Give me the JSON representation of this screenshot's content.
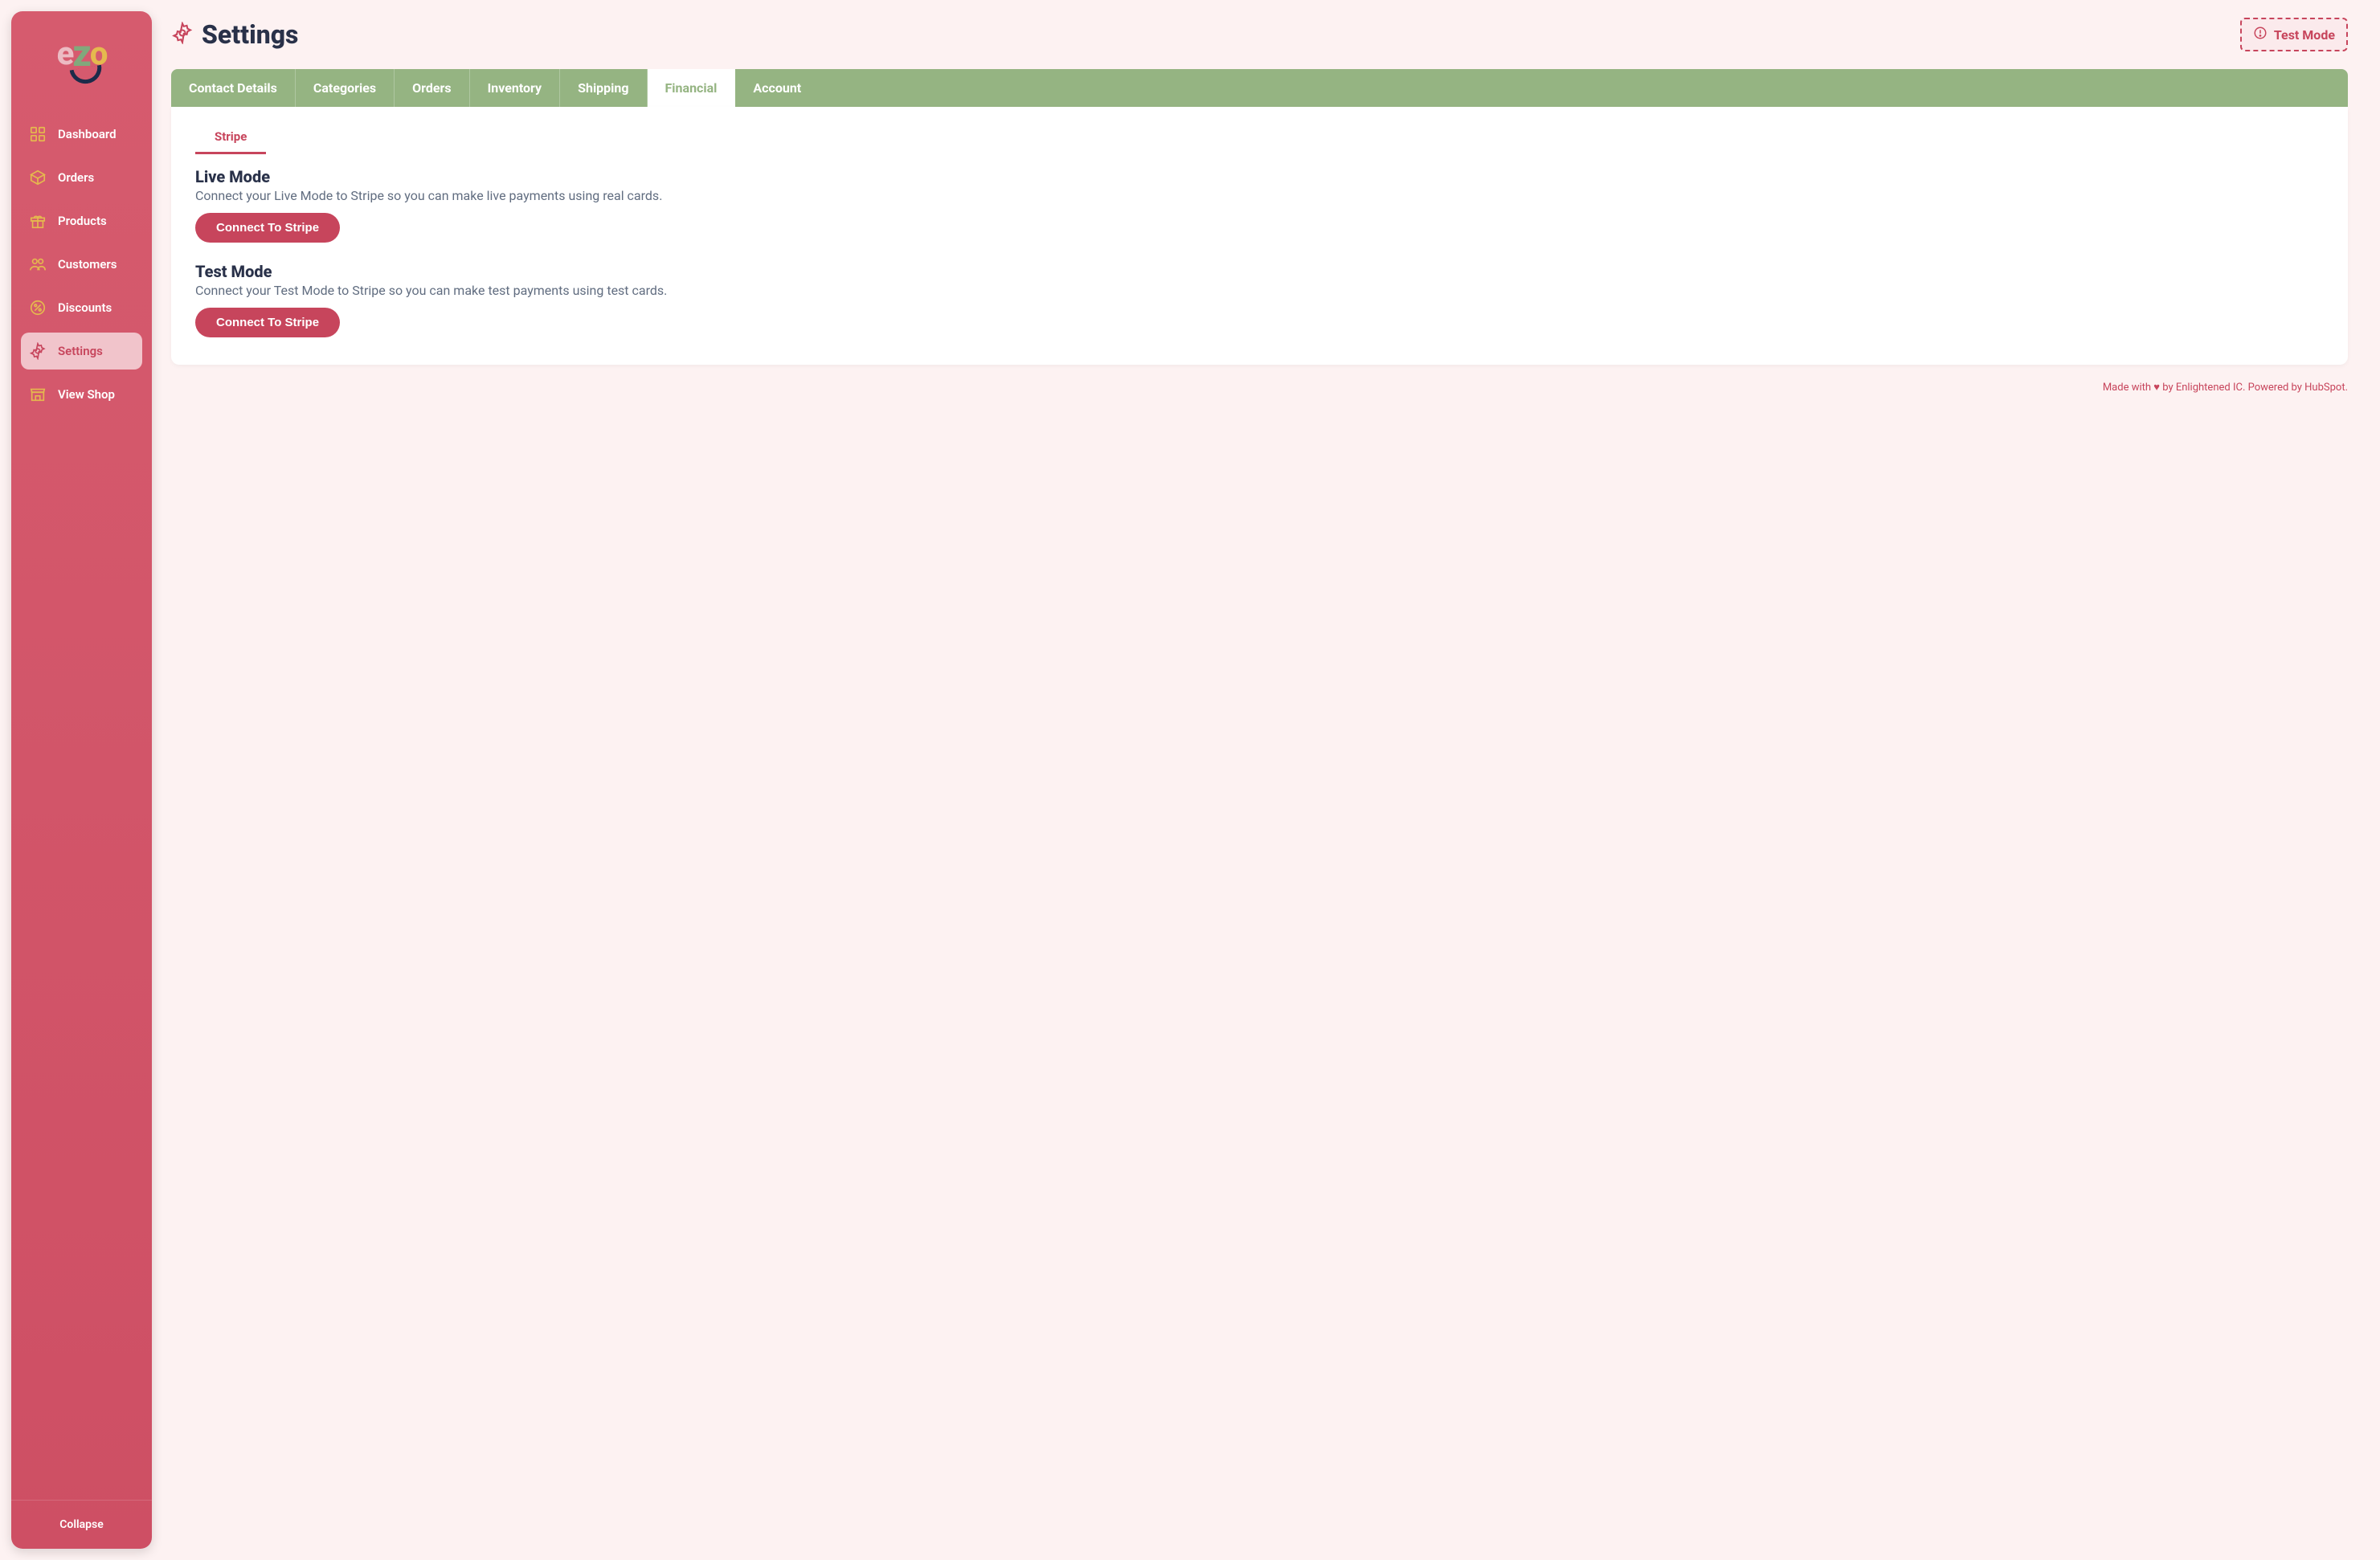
{
  "sidebar": {
    "logo": {
      "e": "e",
      "z": "z",
      "o": "o"
    },
    "items": [
      {
        "label": "Dashboard",
        "icon": "grid-icon"
      },
      {
        "label": "Orders",
        "icon": "package-icon"
      },
      {
        "label": "Products",
        "icon": "gift-icon"
      },
      {
        "label": "Customers",
        "icon": "people-icon"
      },
      {
        "label": "Discounts",
        "icon": "percent-icon"
      },
      {
        "label": "Settings",
        "icon": "gear-icon",
        "active": true
      },
      {
        "label": "View Shop",
        "icon": "shop-icon"
      }
    ],
    "collapse": "Collapse"
  },
  "header": {
    "title": "Settings",
    "testMode": "Test Mode"
  },
  "tabs": [
    {
      "label": "Contact Details"
    },
    {
      "label": "Categories"
    },
    {
      "label": "Orders"
    },
    {
      "label": "Inventory"
    },
    {
      "label": "Shipping"
    },
    {
      "label": "Financial",
      "active": true
    },
    {
      "label": "Account"
    }
  ],
  "subtabs": [
    {
      "label": "Stripe",
      "active": true
    }
  ],
  "sections": {
    "live": {
      "title": "Live Mode",
      "desc": "Connect your Live Mode to Stripe so you can make live payments using real cards.",
      "button": "Connect To Stripe"
    },
    "test": {
      "title": "Test Mode",
      "desc": "Connect your Test Mode to Stripe so you can make test payments using test cards.",
      "button": "Connect To Stripe"
    }
  },
  "footer": {
    "prefix": "Made with ",
    "heart": "♥",
    "mid": " by Enlightened IC. Powered by HubSpot."
  },
  "colors": {
    "accent": "#c7455c",
    "sidebar": "#ce4f64",
    "tabbar": "#95b482",
    "pageBg": "#fdf2f2",
    "textDark": "#293149",
    "textMuted": "#616d80"
  }
}
